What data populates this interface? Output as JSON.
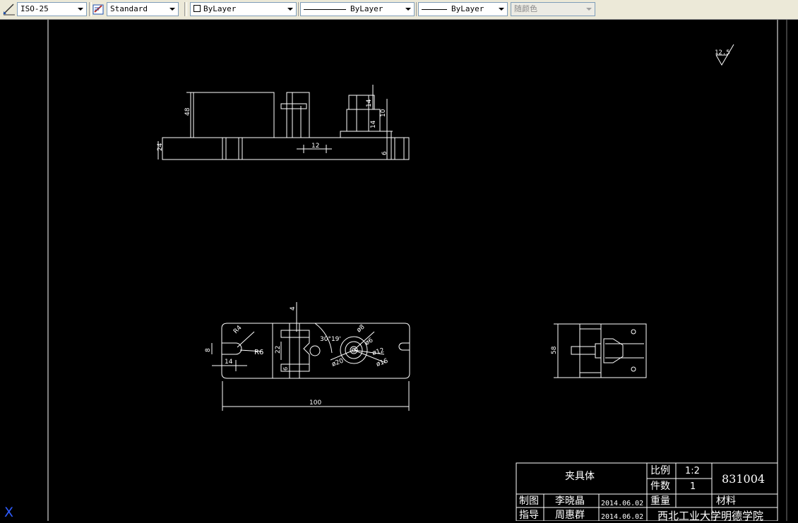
{
  "toolbar": {
    "dim_style": "ISO-25",
    "text_style": "Standard",
    "layer": "ByLayer",
    "linetype": "ByLayer",
    "lineweight": "ByLayer",
    "color": "随颜色"
  },
  "drawing": {
    "roughness": "12.5",
    "front_dims": {
      "d48": "48",
      "d24": "24",
      "d12": "12",
      "d14a": "14",
      "d14b": "14",
      "d10": "10",
      "d6": "6"
    },
    "top_dims": {
      "d4": "4",
      "r4": "R4",
      "r6": "R6",
      "d8": "8",
      "d14": "14",
      "d22": "22",
      "d6": "6",
      "angle": "30°19'",
      "phi8": "ø8",
      "phi6": "ø6",
      "phi12": "ø12",
      "phi16": "ø16",
      "phi20": "ø20",
      "d100": "100"
    },
    "side_dims": {
      "d58": "58"
    }
  },
  "title_block": {
    "part_name": "夹具体",
    "scale_label": "比例",
    "scale_value": "1:2",
    "qty_label": "件数",
    "qty_value": "1",
    "drawing_no": "831004",
    "drawn_label": "制图",
    "drawn_name": "李晓晶",
    "drawn_date": "2014.06.02",
    "weight_label": "重量",
    "material_label": "材料",
    "guide_label": "指导",
    "guide_name": "周惠群",
    "guide_date": "2014.06.02",
    "school": "西北工业大学明德学院"
  },
  "ucs_label": "X"
}
